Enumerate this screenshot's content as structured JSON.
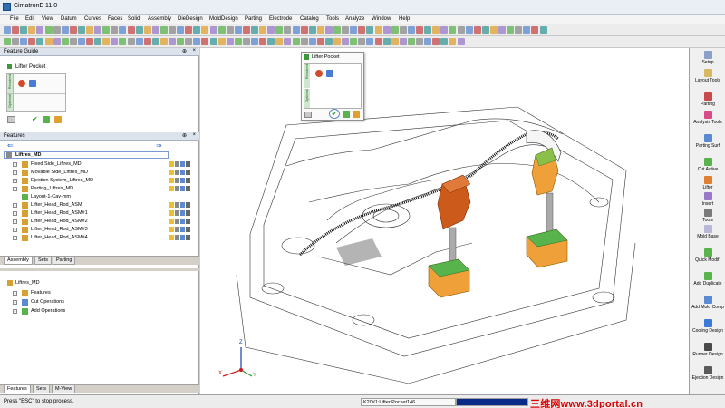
{
  "window": {
    "title": "CimatronE 11.0"
  },
  "menu": [
    "File",
    "Edit",
    "View",
    "Datum",
    "Curves",
    "Faces",
    "Solid",
    "Assembly",
    "DieDesign",
    "MoldDesign",
    "Parting",
    "Electrode",
    "Catalog",
    "Tools",
    "Analyze",
    "Window",
    "Help"
  ],
  "feature_guide": {
    "header": "Feature Guide",
    "title": "Lifter Pocket",
    "side_required": "Required",
    "side_optional": "Optional",
    "pin_icon": "pin-icon",
    "close_icon": "close-icon"
  },
  "features_panel": {
    "header": "Features",
    "root": "Liftres_MD",
    "items": [
      {
        "label": "Fixed Side_Liftres_MD",
        "expand": "+"
      },
      {
        "label": "Movable Side_Liftres_MD",
        "expand": "+"
      },
      {
        "label": "Ejection System_Liftres_MD",
        "expand": "+"
      },
      {
        "label": "Parting_Liftres_MD",
        "expand": "+"
      },
      {
        "label": "Layout-1-Cav-mm",
        "expand": ""
      },
      {
        "label": "Lifter_Head_Rod_ASM",
        "expand": "+"
      },
      {
        "label": "Lifter_Head_Rod_ASM#1",
        "expand": "+"
      },
      {
        "label": "Lifter_Head_Rod_ASM#2",
        "expand": "+"
      },
      {
        "label": "Lifter_Head_Rod_ASM#3",
        "expand": "+"
      },
      {
        "label": "Lifter_Head_Rod_ASM#4",
        "expand": "+"
      }
    ],
    "tabs": [
      "Assembly",
      "Sets",
      "Parting"
    ]
  },
  "bottom_panel": {
    "root": "Liftres_MD",
    "items": [
      {
        "label": "Features",
        "expand": "+"
      },
      {
        "label": "Cut Operations",
        "expand": "+"
      },
      {
        "label": "Add Operations",
        "expand": "+"
      }
    ],
    "tabs": [
      "Features",
      "Sets",
      "M-View"
    ]
  },
  "popup": {
    "title": "Lifter Pocket",
    "side_required": "Required",
    "side_optional": "Optional"
  },
  "right_tools": [
    {
      "label": "Setup"
    },
    {
      "label": "Layout Tools"
    },
    {
      "label": "Parting"
    },
    {
      "label": "Analysis Tools"
    },
    {
      "label": "Parting Surf"
    },
    {
      "label": "Cut Active"
    },
    {
      "label": "Lifter"
    },
    {
      "label": "Insert"
    },
    {
      "label": "Tools"
    },
    {
      "label": "Mold Base"
    },
    {
      "label": "Quick Modif."
    },
    {
      "label": "Add Duplicate"
    },
    {
      "label": "Add Mold Comp"
    },
    {
      "label": "Cooling Design"
    },
    {
      "label": "Runner Design"
    },
    {
      "label": "Ejection Design"
    }
  ],
  "status": {
    "message": "Press \"ESC\" to stop process.",
    "feature_id": "K20#1:Lifter Pocket146",
    "progress_fraction": 1,
    "watermark": "三维网www.3dportal.cn"
  },
  "axis": {
    "x": "X",
    "y": "Y",
    "z": "Z"
  },
  "colors": {
    "lifter_head_active": "#cc5a1a",
    "lifter_base": "#f0a038",
    "accent_green": "#59b34d"
  }
}
